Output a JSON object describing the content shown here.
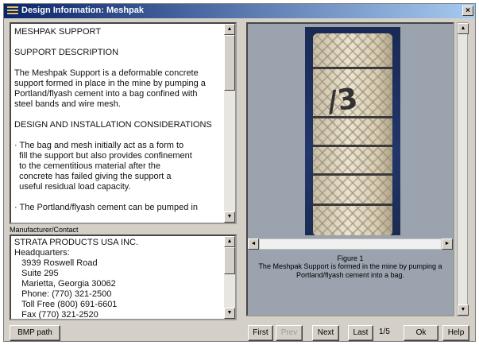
{
  "window": {
    "title": "Design Information: Meshpak",
    "close_glyph": "×"
  },
  "description": {
    "paragraphs": [
      "MESHPAK SUPPORT",
      "SUPPORT DESCRIPTION",
      "The Meshpak Support is a deformable concrete\nsupport formed in place in the mine by pumping a\nPortland/flyash cement into a bag confined with\nsteel bands and wire mesh.",
      "DESIGN AND INSTALLATION CONSIDERATIONS",
      "· The bag and mesh initially act as a form to\n  fill the support but also provides confinement\n  to the cementitious material after the\n  concrete has failed giving the support a\n  useful residual load capacity.",
      "· The Portland/flyash cement can be pumped in"
    ]
  },
  "manufacturer": {
    "label": "Manufacturer/Contact",
    "lines": [
      "STRATA PRODUCTS USA INC.",
      "Headquarters:",
      "   3939 Roswell Road",
      "   Suite 295",
      "   Marietta, Georgia 30062",
      "   Phone: (770) 321-2500",
      "   Toll Free (800) 691-6601",
      "   Fax (770) 321-2520"
    ]
  },
  "figure": {
    "photo_marking": "/3",
    "title": "Figure 1",
    "caption": "The Meshpak Support is formed in the mine by pumping a Portland/flyash cement into a bag."
  },
  "buttons": {
    "bmp_path": "BMP path",
    "first": "First",
    "prev": "Prev",
    "next": "Next",
    "last": "Last",
    "ok": "Ok",
    "help": "Help"
  },
  "pager": {
    "indicator": "1/5"
  },
  "icons": {
    "scroll_up": "▲",
    "scroll_down": "▼",
    "scroll_left": "◄",
    "scroll_right": "►"
  },
  "colors": {
    "titlebar_start": "#0a246a",
    "titlebar_end": "#a6caf0",
    "face": "#d4d0c8",
    "caption_panel": "#9aa3ae"
  }
}
